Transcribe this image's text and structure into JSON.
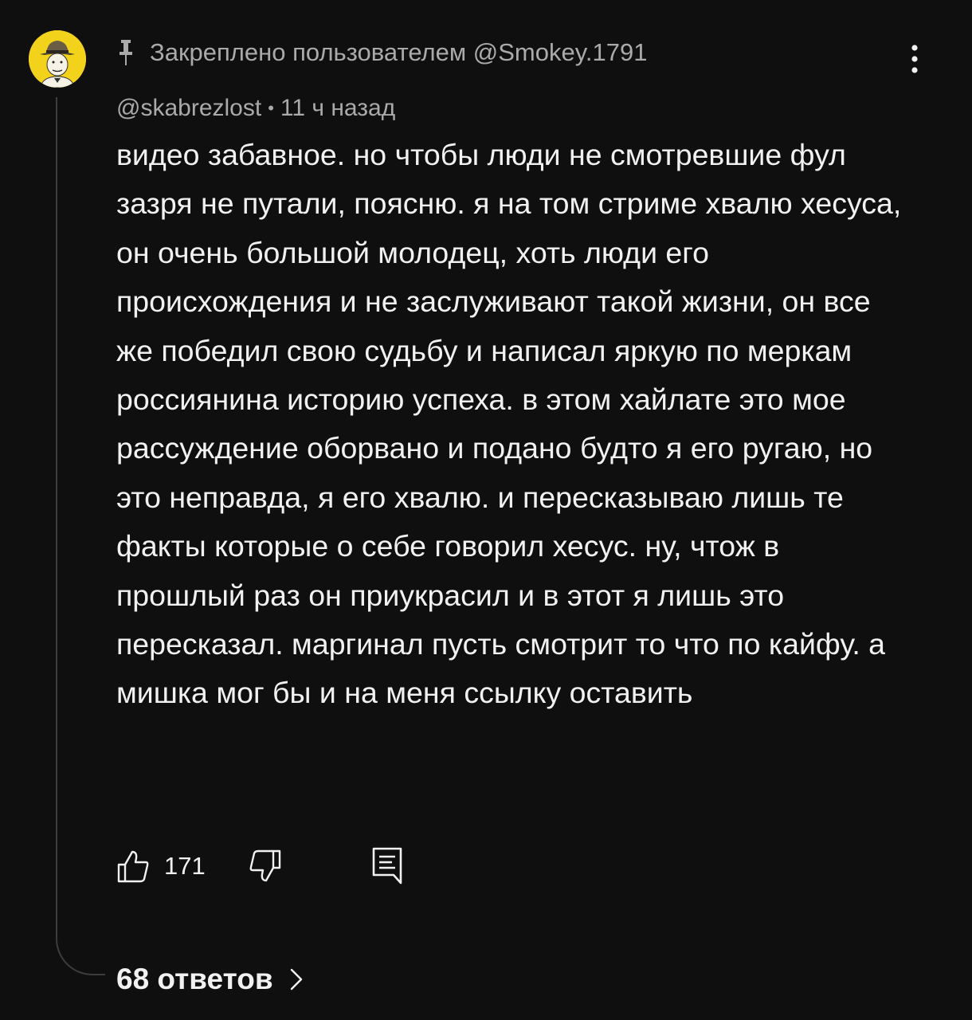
{
  "pinned": {
    "label": "Закреплено пользователем @Smokey.1791"
  },
  "comment": {
    "author": "@skabrezlost",
    "separator": "•",
    "time": "11 ч назад",
    "text": "видео забавное. но чтобы люди не смотревшие фул зазря не путали, поясню. я на том стриме хвалю хесуса, он очень большой молодец, хоть люди его происхождения и не заслуживают такой жизни, он все же победил свою судьбу и написал яркую по меркам россиянина историю успеха. в этом хайлате это мое рассуждение оборвано и подано будто я его ругаю, но это неправда, я его хвалю. и пересказываю лишь те факты которые о себе говорил хесус. ну, чтож в прошлый раз он приукрасил и в этот я лишь это пересказал. маргинал пусть смотрит то что по кайфу. а мишка мог бы и на меня ссылку оставить"
  },
  "actions": {
    "like_count": "171",
    "icons": [
      "thumbs-up-icon",
      "thumbs-down-icon",
      "reply-icon",
      "more-vert-icon",
      "pin-icon",
      "chevron-right-icon"
    ]
  },
  "replies": {
    "label": "68 ответов"
  },
  "colors": {
    "background": "#0f0f0f",
    "text_primary": "#f1f1f1",
    "text_secondary": "#aaaaaa",
    "avatar_bg": "#f2d21a",
    "thread_line": "#3d3d3d"
  }
}
